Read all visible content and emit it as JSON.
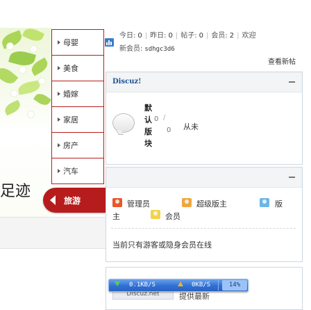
{
  "banner": {
    "text": "足迹"
  },
  "categories": {
    "items": [
      {
        "label": "母婴"
      },
      {
        "label": "美食"
      },
      {
        "label": "婚嫁"
      },
      {
        "label": "家居"
      },
      {
        "label": "房产"
      },
      {
        "label": "汽车"
      }
    ],
    "active": {
      "label": "旅游"
    }
  },
  "stats": {
    "today_label": "今日:",
    "today": "0",
    "yesterday_label": "昨日:",
    "yesterday": "0",
    "posts_label": "帖子:",
    "posts": "0",
    "members_label": "会员:",
    "members": "2",
    "welcome_label": "欢迎",
    "newmember_label": "新会员:",
    "newmember": "sdhgc3d6",
    "view_new_label": "查看新帖"
  },
  "forum_panel": {
    "title": "Discuz!",
    "forum_name": "默认版块",
    "threads": "0",
    "posts": "0",
    "slash": "/",
    "last_post": "从未"
  },
  "online_panel": {
    "legend": [
      {
        "label": "管理员",
        "color": "#e8572a"
      },
      {
        "label": "超级版主",
        "color": "#f0a640"
      },
      {
        "label": "版",
        "color": "#6cb6e8"
      },
      {
        "label": "主"
      },
      {
        "label": "会员",
        "color": "#f2d34a"
      }
    ],
    "status_text": "当前只有游客或隐身会员在线"
  },
  "bottom_panel": {
    "logo_text": "Discuz.net",
    "text": "提供最新"
  },
  "speed_widget": {
    "down": "0.1KB/S",
    "up": "0KB/S",
    "percent": "14%"
  },
  "colors": {
    "accent_red": "#b71c1c",
    "link_blue": "#1b4f8f"
  }
}
